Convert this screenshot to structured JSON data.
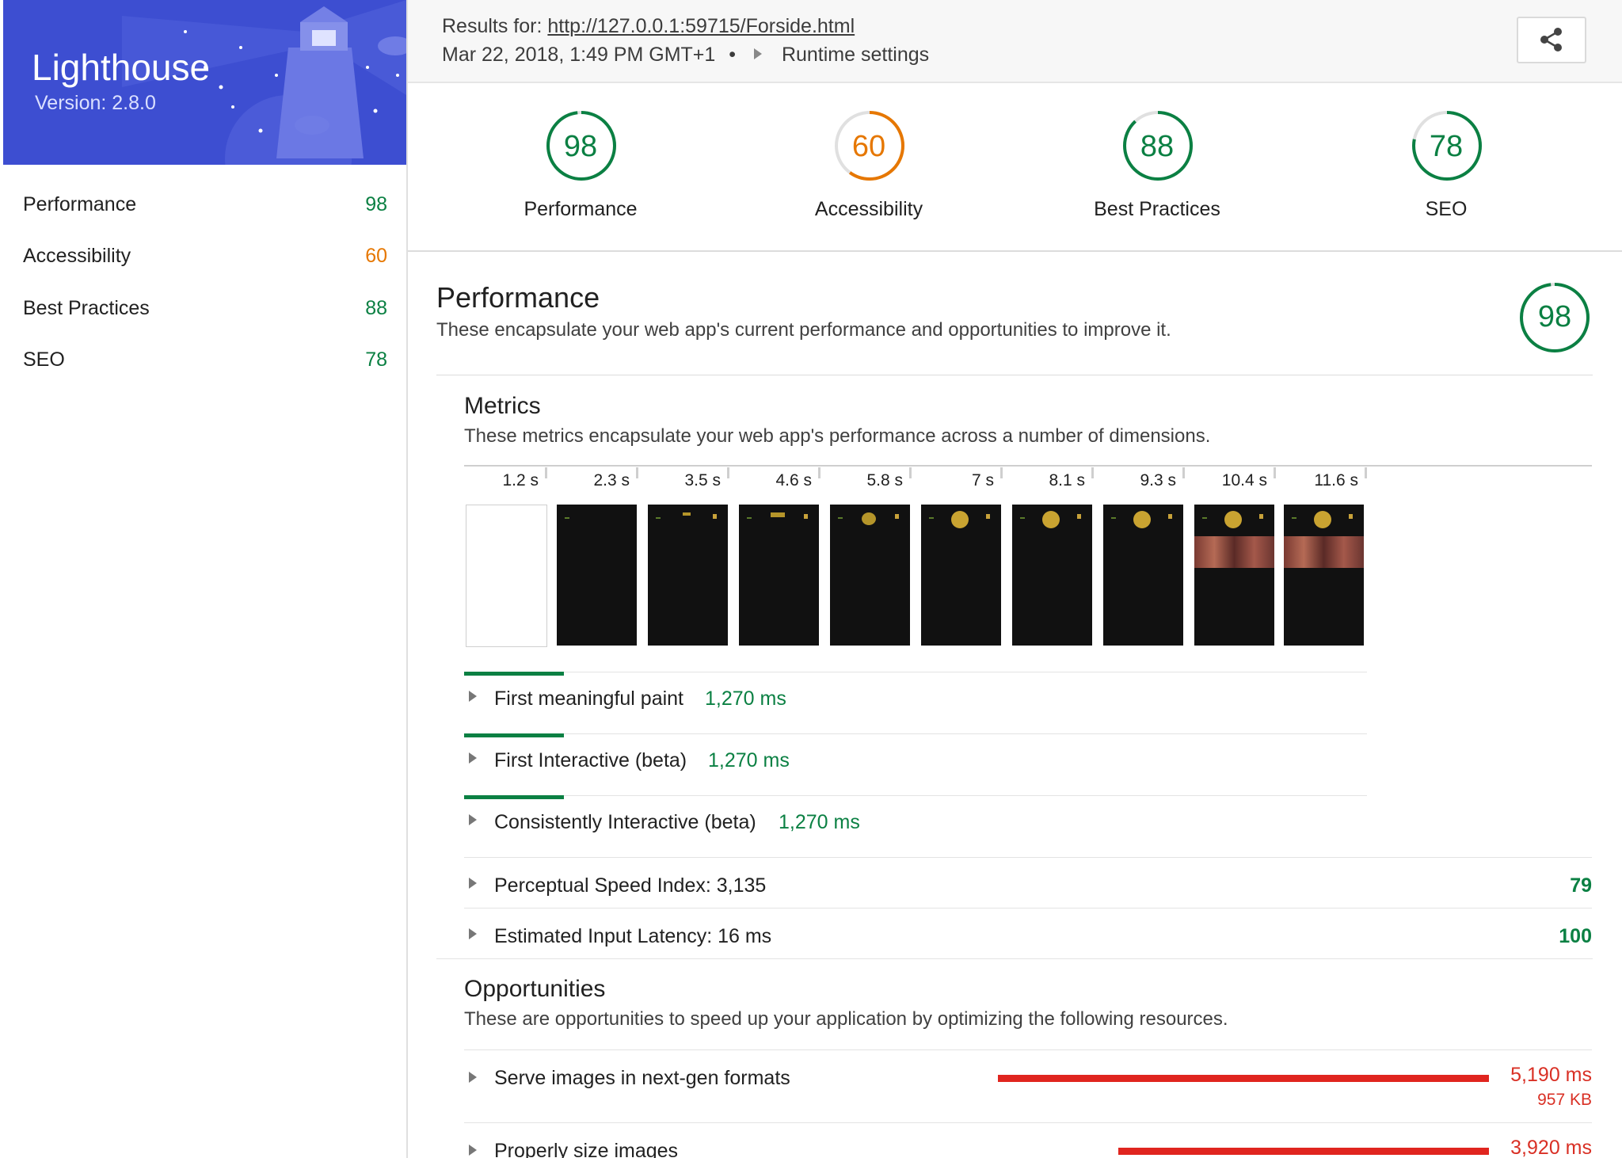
{
  "sidebar": {
    "app_title": "Lighthouse",
    "version": "Version: 2.8.0",
    "items": [
      {
        "label": "Performance",
        "score": "98"
      },
      {
        "label": "Accessibility",
        "score": "60"
      },
      {
        "label": "Best Practices",
        "score": "88"
      },
      {
        "label": "SEO",
        "score": "78"
      }
    ]
  },
  "header": {
    "results_prefix": "Results for:",
    "url": "http://127.0.0.1:59715/Forside.html",
    "timestamp": "Mar 22, 2018, 1:49 PM GMT+1",
    "bullet": "•",
    "runtime_settings": "Runtime settings",
    "share_icon": "share-icon"
  },
  "gauges": [
    {
      "label": "Performance",
      "score": "98",
      "value": 98,
      "color": "#0b8043"
    },
    {
      "label": "Accessibility",
      "score": "60",
      "value": 60,
      "color": "#e67700"
    },
    {
      "label": "Best Practices",
      "score": "88",
      "value": 88,
      "color": "#0b8043"
    },
    {
      "label": "SEO",
      "score": "78",
      "value": 78,
      "color": "#0b8043"
    }
  ],
  "performance": {
    "title": "Performance",
    "description": "These encapsulate your web app's current performance and opportunities to improve it.",
    "score": "98",
    "score_value": 98
  },
  "metrics": {
    "title": "Metrics",
    "description": "These metrics encapsulate your web app's performance across a number of dimensions.",
    "filmstrip_times": [
      "1.2 s",
      "2.3 s",
      "3.5 s",
      "4.6 s",
      "5.8 s",
      "7 s",
      "8.1 s",
      "9.3 s",
      "10.4 s",
      "11.6 s"
    ],
    "rows": [
      {
        "label": "First meaningful paint",
        "value": "1,270 ms"
      },
      {
        "label": "First Interactive (beta)",
        "value": "1,270 ms"
      },
      {
        "label": "Consistently Interactive (beta)",
        "value": "1,270 ms"
      },
      {
        "label": "Perceptual Speed Index: 3,135",
        "score": "79"
      },
      {
        "label": "Estimated Input Latency: 16 ms",
        "score": "100"
      }
    ]
  },
  "opportunities": {
    "title": "Opportunities",
    "description": "These are opportunities to speed up your application by optimizing the following resources.",
    "rows": [
      {
        "label": "Serve images in next-gen formats",
        "time": "5,190 ms",
        "size": "957 KB",
        "fraction": 1.0
      },
      {
        "label": "Properly size images",
        "time": "3,920 ms",
        "fraction": 0.755
      }
    ]
  },
  "colors": {
    "brand": "#3d4ed1",
    "pass": "#0b8043",
    "average": "#e67700",
    "fail": "#e0251f"
  }
}
